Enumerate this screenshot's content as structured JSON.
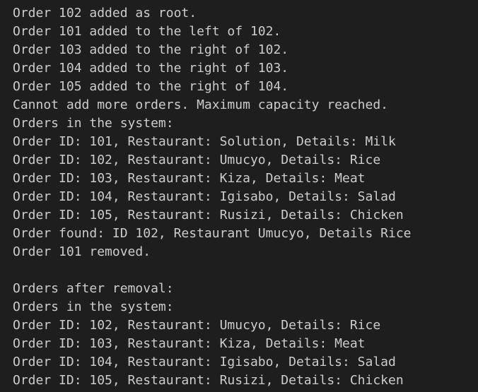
{
  "terminal": {
    "lines": [
      "Order 102 added as root.",
      "Order 101 added to the left of 102.",
      "Order 103 added to the right of 102.",
      "Order 104 added to the right of 103.",
      "Order 105 added to the right of 104.",
      "Cannot add more orders. Maximum capacity reached.",
      "Orders in the system:",
      "Order ID: 101, Restaurant: Solution, Details: Milk",
      "Order ID: 102, Restaurant: Umucyo, Details: Rice",
      "Order ID: 103, Restaurant: Kiza, Details: Meat",
      "Order ID: 104, Restaurant: Igisabo, Details: Salad",
      "Order ID: 105, Restaurant: Rusizi, Details: Chicken",
      "Order found: ID 102, Restaurant Umucyo, Details Rice",
      "Order 101 removed.",
      "",
      "Orders after removal:",
      "Orders in the system:",
      "Order ID: 102, Restaurant: Umucyo, Details: Rice",
      "Order ID: 103, Restaurant: Kiza, Details: Meat",
      "Order ID: 104, Restaurant: Igisabo, Details: Salad",
      "Order ID: 105, Restaurant: Rusizi, Details: Chicken"
    ]
  },
  "colors": {
    "background": "#1e1e1e",
    "text": "#cccccc",
    "cut_off_line_accent": "#3b8eea"
  }
}
